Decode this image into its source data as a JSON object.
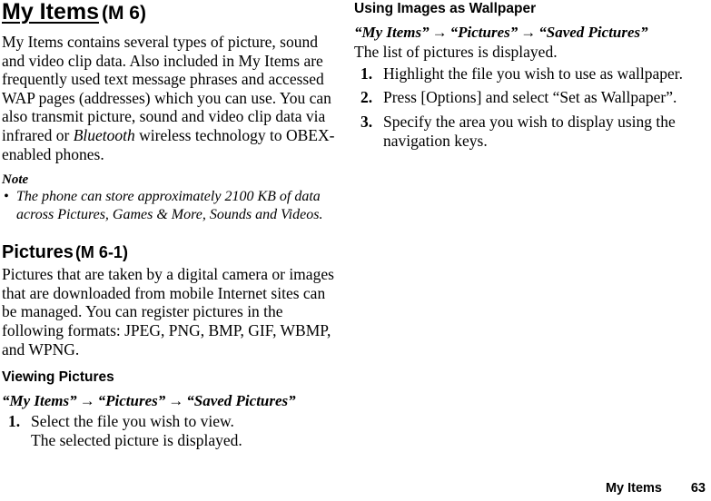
{
  "document": {
    "chapter": {
      "title": "My Items",
      "menu_code": "(M 6)"
    },
    "intro_paragraph": {
      "before_italic": "My Items contains several types of picture, sound and video clip data. Also included in My Items are frequently used text message phrases and accessed WAP pages (addresses) which you can use. You can also transmit picture, sound and video clip data via infrared or ",
      "italic_word": "Bluetooth",
      "after_italic": " wireless technology to OBEX-enabled phones."
    },
    "note": {
      "heading": "Note",
      "bullet_glyph": "•",
      "items": [
        "The phone can store approximately 2100 KB of data across Pictures, Games & More, Sounds and Videos."
      ]
    },
    "pictures_section": {
      "title": "Pictures",
      "menu_code": "(M 6-1)",
      "paragraph": "Pictures that are taken by a digital camera or images that are downloaded from mobile Internet sites can be managed. You can register pictures in the following formats: JPEG, PNG, BMP, GIF, WBMP, and WPNG."
    },
    "viewing_pictures": {
      "heading": "Viewing Pictures",
      "path": {
        "step1": "“My Items”",
        "arrow": "→",
        "step2": "“Pictures”",
        "step3": "“Saved Pictures”"
      },
      "steps": [
        {
          "number": "1.",
          "text": "Select the file you wish to view."
        }
      ],
      "result": "The selected picture is displayed."
    },
    "using_images_as_wallpaper": {
      "heading": "Using Images as Wallpaper",
      "path": {
        "step1": "“My Items”",
        "arrow": "→",
        "step2": "“Pictures”",
        "step3": "“Saved Pictures”"
      },
      "intro": "The list of pictures is displayed.",
      "steps": [
        {
          "number": "1.",
          "text": "Highlight the file you wish to use as wallpaper."
        },
        {
          "number": "2.",
          "text": "Press [Options] and select “Set as Wallpaper”."
        },
        {
          "number": "3.",
          "text": "Specify the area you wish to display using the navigation keys."
        }
      ]
    },
    "footer": {
      "section_name": "My Items",
      "page_number": "63"
    }
  }
}
